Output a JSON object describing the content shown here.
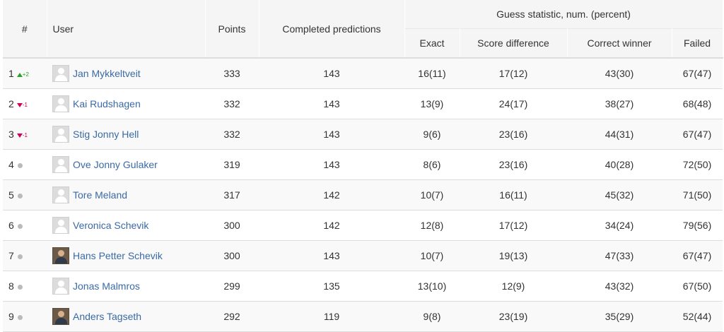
{
  "headers": {
    "rank": "#",
    "user": "User",
    "points": "Points",
    "completed": "Completed predictions",
    "guess_group": "Guess statistic, num. (percent)",
    "exact": "Exact",
    "score_difference": "Score difference",
    "correct_winner": "Correct winner",
    "failed": "Failed"
  },
  "colors": {
    "trend_up": "#2ca02c",
    "trend_down": "#d1005a",
    "trend_none": "#bbbbbb",
    "link": "#3a6aa5"
  },
  "rows": [
    {
      "rank": "1",
      "trend": "up",
      "trend_value": "+2",
      "avatar": "default-avatar-icon",
      "name": "Jan Mykkeltveit",
      "points": "333",
      "completed": "143",
      "exact": "16(11)",
      "score_difference": "17(12)",
      "correct_winner": "43(30)",
      "failed": "67(47)"
    },
    {
      "rank": "2",
      "trend": "down",
      "trend_value": "-1",
      "avatar": "default-avatar-icon",
      "name": "Kai Rudshagen",
      "points": "332",
      "completed": "143",
      "exact": "13(9)",
      "score_difference": "24(17)",
      "correct_winner": "38(27)",
      "failed": "68(48)"
    },
    {
      "rank": "3",
      "trend": "down",
      "trend_value": "-1",
      "avatar": "default-avatar-icon",
      "name": "Stig Jonny Hell",
      "points": "332",
      "completed": "143",
      "exact": "9(6)",
      "score_difference": "23(16)",
      "correct_winner": "44(31)",
      "failed": "67(47)"
    },
    {
      "rank": "4",
      "trend": "none",
      "trend_value": "",
      "avatar": "default-avatar-icon",
      "name": "Ove Jonny Gulaker",
      "points": "319",
      "completed": "143",
      "exact": "8(6)",
      "score_difference": "23(16)",
      "correct_winner": "40(28)",
      "failed": "72(50)"
    },
    {
      "rank": "5",
      "trend": "none",
      "trend_value": "",
      "avatar": "default-avatar-icon",
      "name": "Tore Meland",
      "points": "317",
      "completed": "142",
      "exact": "10(7)",
      "score_difference": "16(11)",
      "correct_winner": "45(32)",
      "failed": "71(50)"
    },
    {
      "rank": "6",
      "trend": "none",
      "trend_value": "",
      "avatar": "default-avatar-icon",
      "name": "Veronica Schevik",
      "points": "300",
      "completed": "142",
      "exact": "12(8)",
      "score_difference": "17(12)",
      "correct_winner": "34(24)",
      "failed": "79(56)"
    },
    {
      "rank": "7",
      "trend": "none",
      "trend_value": "",
      "avatar": "user-photo-icon",
      "name": "Hans Petter Schevik",
      "points": "300",
      "completed": "143",
      "exact": "10(7)",
      "score_difference": "19(13)",
      "correct_winner": "47(33)",
      "failed": "67(47)"
    },
    {
      "rank": "8",
      "trend": "none",
      "trend_value": "",
      "avatar": "default-avatar-icon",
      "name": "Jonas Malmros",
      "points": "299",
      "completed": "135",
      "exact": "13(10)",
      "score_difference": "12(9)",
      "correct_winner": "43(32)",
      "failed": "67(50)"
    },
    {
      "rank": "9",
      "trend": "none",
      "trend_value": "",
      "avatar": "user-photo-icon",
      "name": "Anders Tagseth",
      "points": "292",
      "completed": "119",
      "exact": "9(8)",
      "score_difference": "23(19)",
      "correct_winner": "35(29)",
      "failed": "52(44)"
    }
  ]
}
